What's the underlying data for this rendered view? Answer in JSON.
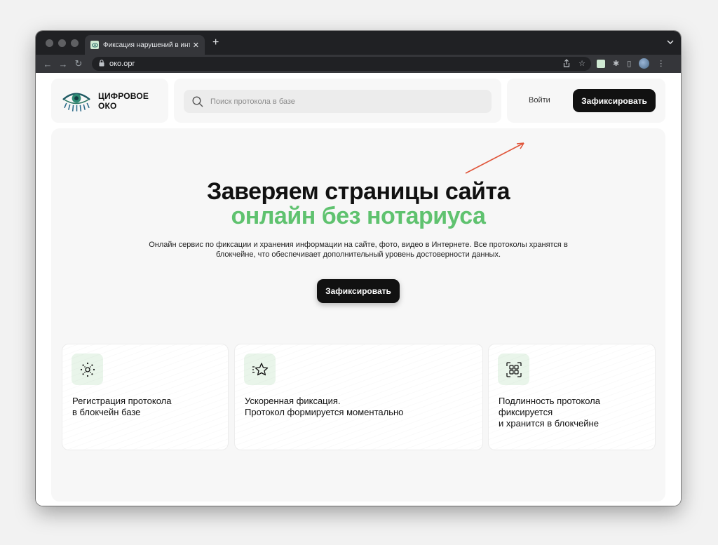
{
  "browser": {
    "tab_title": "Фиксация нарушений в интер",
    "tab_close": "✕",
    "new_tab": "+",
    "url": "око.орг"
  },
  "header": {
    "logo_text": "ЦИФРОВОЕ ОКО",
    "search_placeholder": "Поиск протокола в базе",
    "login_label": "Войти",
    "fix_button_label": "Зафиксировать"
  },
  "hero": {
    "title": "Заверяем страницы сайта",
    "title_accent": "онлайн без нотариуса",
    "description": "Онлайн сервис по фиксации и хранения информации на сайте, фото, видео в Интернете. Все протоколы хранятся в блокчейне, что обеспечивает дополнительный уровень достоверности данных.",
    "cta_label": "Зафиксировать"
  },
  "features": [
    {
      "icon": "blockchain-icon",
      "lines": [
        "Регистрация протокола",
        "в блокчейн базе"
      ]
    },
    {
      "icon": "star-icon",
      "lines": [
        "Ускоренная фиксация.",
        "Протокол формируется моментально"
      ]
    },
    {
      "icon": "scan-icon",
      "lines": [
        "Подлинность протокола",
        "фиксируется",
        "и хранится в блокчейне"
      ]
    }
  ],
  "colors": {
    "accent": "#5fc26f",
    "button": "#111111",
    "arrow": "#e0553a"
  }
}
